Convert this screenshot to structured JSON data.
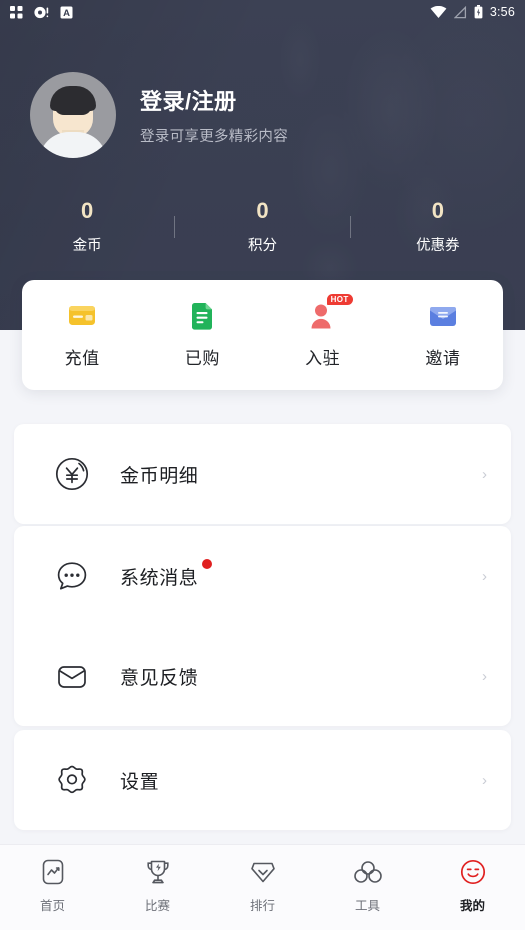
{
  "statusbar": {
    "icons": [
      "grid-apps-icon",
      "record-dot-icon",
      "letter-a-box-icon"
    ],
    "wifi_icon": "wifi-icon",
    "signal_icon": "signal-off-icon",
    "battery_icon": "battery-icon",
    "time": "3:56"
  },
  "profile": {
    "avatar": "default-user-avatar",
    "title": "登录/注册",
    "subtitle": "登录可享更多精彩内容"
  },
  "stats": [
    {
      "value": "0",
      "label": "金币"
    },
    {
      "value": "0",
      "label": "积分"
    },
    {
      "value": "0",
      "label": "优惠券"
    }
  ],
  "quick_actions": [
    {
      "label": "充值",
      "icon": "wallet-card-icon",
      "color": "#f5c22b",
      "badge": ""
    },
    {
      "label": "已购",
      "icon": "document-icon",
      "color": "#21b35a",
      "badge": ""
    },
    {
      "label": "入驻",
      "icon": "user-join-icon",
      "color": "#ee6b6b",
      "badge": "HOT"
    },
    {
      "label": "邀请",
      "icon": "envelope-icon",
      "color": "#5b7fe0",
      "badge": ""
    }
  ],
  "menu_groups": [
    {
      "items": [
        {
          "label": "金币明细",
          "icon": "yen-coin-icon",
          "dot": false,
          "arrow": "›"
        }
      ]
    },
    {
      "items": [
        {
          "label": "系统消息",
          "icon": "chat-bubble-icon",
          "dot": true,
          "arrow": "›"
        },
        {
          "label": "意见反馈",
          "icon": "mail-outline-icon",
          "dot": false,
          "arrow": "›"
        }
      ]
    },
    {
      "items": [
        {
          "label": "设置",
          "icon": "gear-icon",
          "dot": false,
          "arrow": "›"
        }
      ]
    }
  ],
  "tabs": [
    {
      "label": "首页",
      "icon": "home-chart-icon",
      "active": false
    },
    {
      "label": "比赛",
      "icon": "trophy-icon",
      "active": false
    },
    {
      "label": "排行",
      "icon": "diamond-rank-icon",
      "active": false
    },
    {
      "label": "工具",
      "icon": "tools-circles-icon",
      "active": false
    },
    {
      "label": "我的",
      "icon": "smiley-profile-icon",
      "active": true
    }
  ],
  "colors": {
    "header_bg": "#3a3f52",
    "page_bg": "#f4f5f9",
    "accent_red": "#e02020",
    "stat_gold": "#f2e4c4",
    "active_tab": "#e02020"
  }
}
